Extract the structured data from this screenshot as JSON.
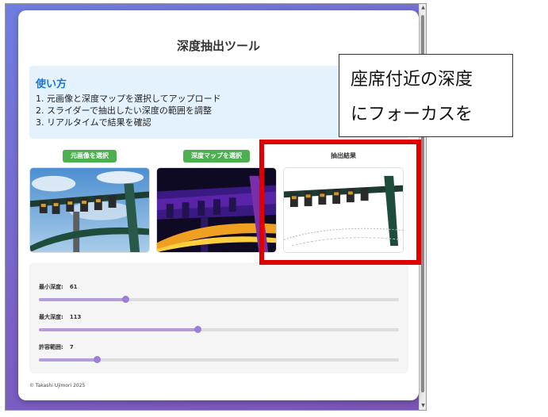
{
  "app": {
    "title": "深度抽出ツール",
    "footer": "© Takashi Ujimori 2025"
  },
  "howto": {
    "title": "使い方",
    "steps": [
      "1. 元画像と深度マップを選択してアップロード",
      "2. スライダーで抽出したい深度の範囲を調整",
      "3. リアルタイムで結果を確認"
    ]
  },
  "images": {
    "original_button": "元画像を選択",
    "depth_button": "深度マップを選択",
    "result_label": "抽出結果"
  },
  "controls": [
    {
      "label": "最小深度:",
      "value": "61",
      "fraction": 0.24
    },
    {
      "label": "最大深度:",
      "value": "113",
      "fraction": 0.44
    },
    {
      "label": "許容範囲:",
      "value": "7",
      "fraction": 0.16
    }
  ],
  "annotation": {
    "line1": "座席付近の深度",
    "line2": "にフォーカスを"
  },
  "colors": {
    "accent_green": "#4caf50",
    "slider": "#9c7fd1",
    "highlight": "#e00000"
  }
}
